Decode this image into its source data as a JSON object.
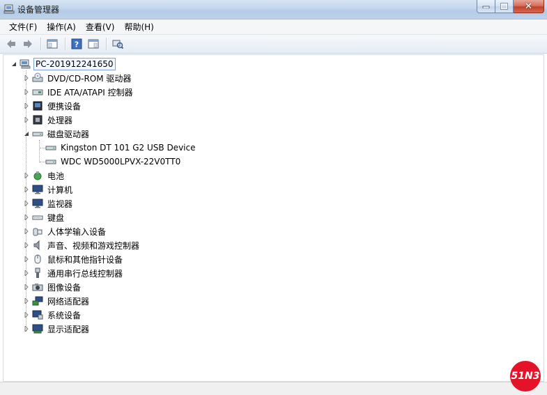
{
  "window": {
    "title": "设备管理器"
  },
  "menubar": {
    "items": [
      "文件(F)",
      "操作(A)",
      "查看(V)",
      "帮助(H)"
    ]
  },
  "toolbar": {
    "buttons": [
      "back-arrow-icon",
      "forward-arrow-icon",
      "properties-icon",
      "help-icon",
      "view-icon",
      "scan-hardware-icon"
    ]
  },
  "tree": {
    "root": "PC-201912241650",
    "categories": [
      {
        "label": "DVD/CD-ROM 驱动器",
        "icon": "dvd-drive-icon",
        "expanded": false
      },
      {
        "label": "IDE ATA/ATAPI 控制器",
        "icon": "ide-controller-icon",
        "expanded": false
      },
      {
        "label": "便携设备",
        "icon": "portable-device-icon",
        "expanded": false
      },
      {
        "label": "处理器",
        "icon": "processor-icon",
        "expanded": false
      },
      {
        "label": "磁盘驱动器",
        "icon": "disk-drive-icon",
        "expanded": true,
        "children": [
          "Kingston DT 101 G2 USB Device",
          "WDC WD5000LPVX-22V0TT0"
        ]
      },
      {
        "label": "电池",
        "icon": "battery-icon",
        "expanded": false
      },
      {
        "label": "计算机",
        "icon": "computer-icon",
        "expanded": false
      },
      {
        "label": "监视器",
        "icon": "monitor-icon",
        "expanded": false
      },
      {
        "label": "键盘",
        "icon": "keyboard-icon",
        "expanded": false
      },
      {
        "label": "人体学输入设备",
        "icon": "hid-icon",
        "expanded": false
      },
      {
        "label": "声音、视频和游戏控制器",
        "icon": "speaker-icon",
        "expanded": false
      },
      {
        "label": "鼠标和其他指针设备",
        "icon": "mouse-icon",
        "expanded": false
      },
      {
        "label": "通用串行总线控制器",
        "icon": "usb-icon",
        "expanded": false
      },
      {
        "label": "图像设备",
        "icon": "imaging-device-icon",
        "expanded": false
      },
      {
        "label": "网络适配器",
        "icon": "network-adapter-icon",
        "expanded": false
      },
      {
        "label": "系统设备",
        "icon": "system-device-icon",
        "expanded": false
      },
      {
        "label": "显示适配器",
        "icon": "display-adapter-icon",
        "expanded": false
      }
    ]
  },
  "watermark": {
    "text": "51N3"
  }
}
